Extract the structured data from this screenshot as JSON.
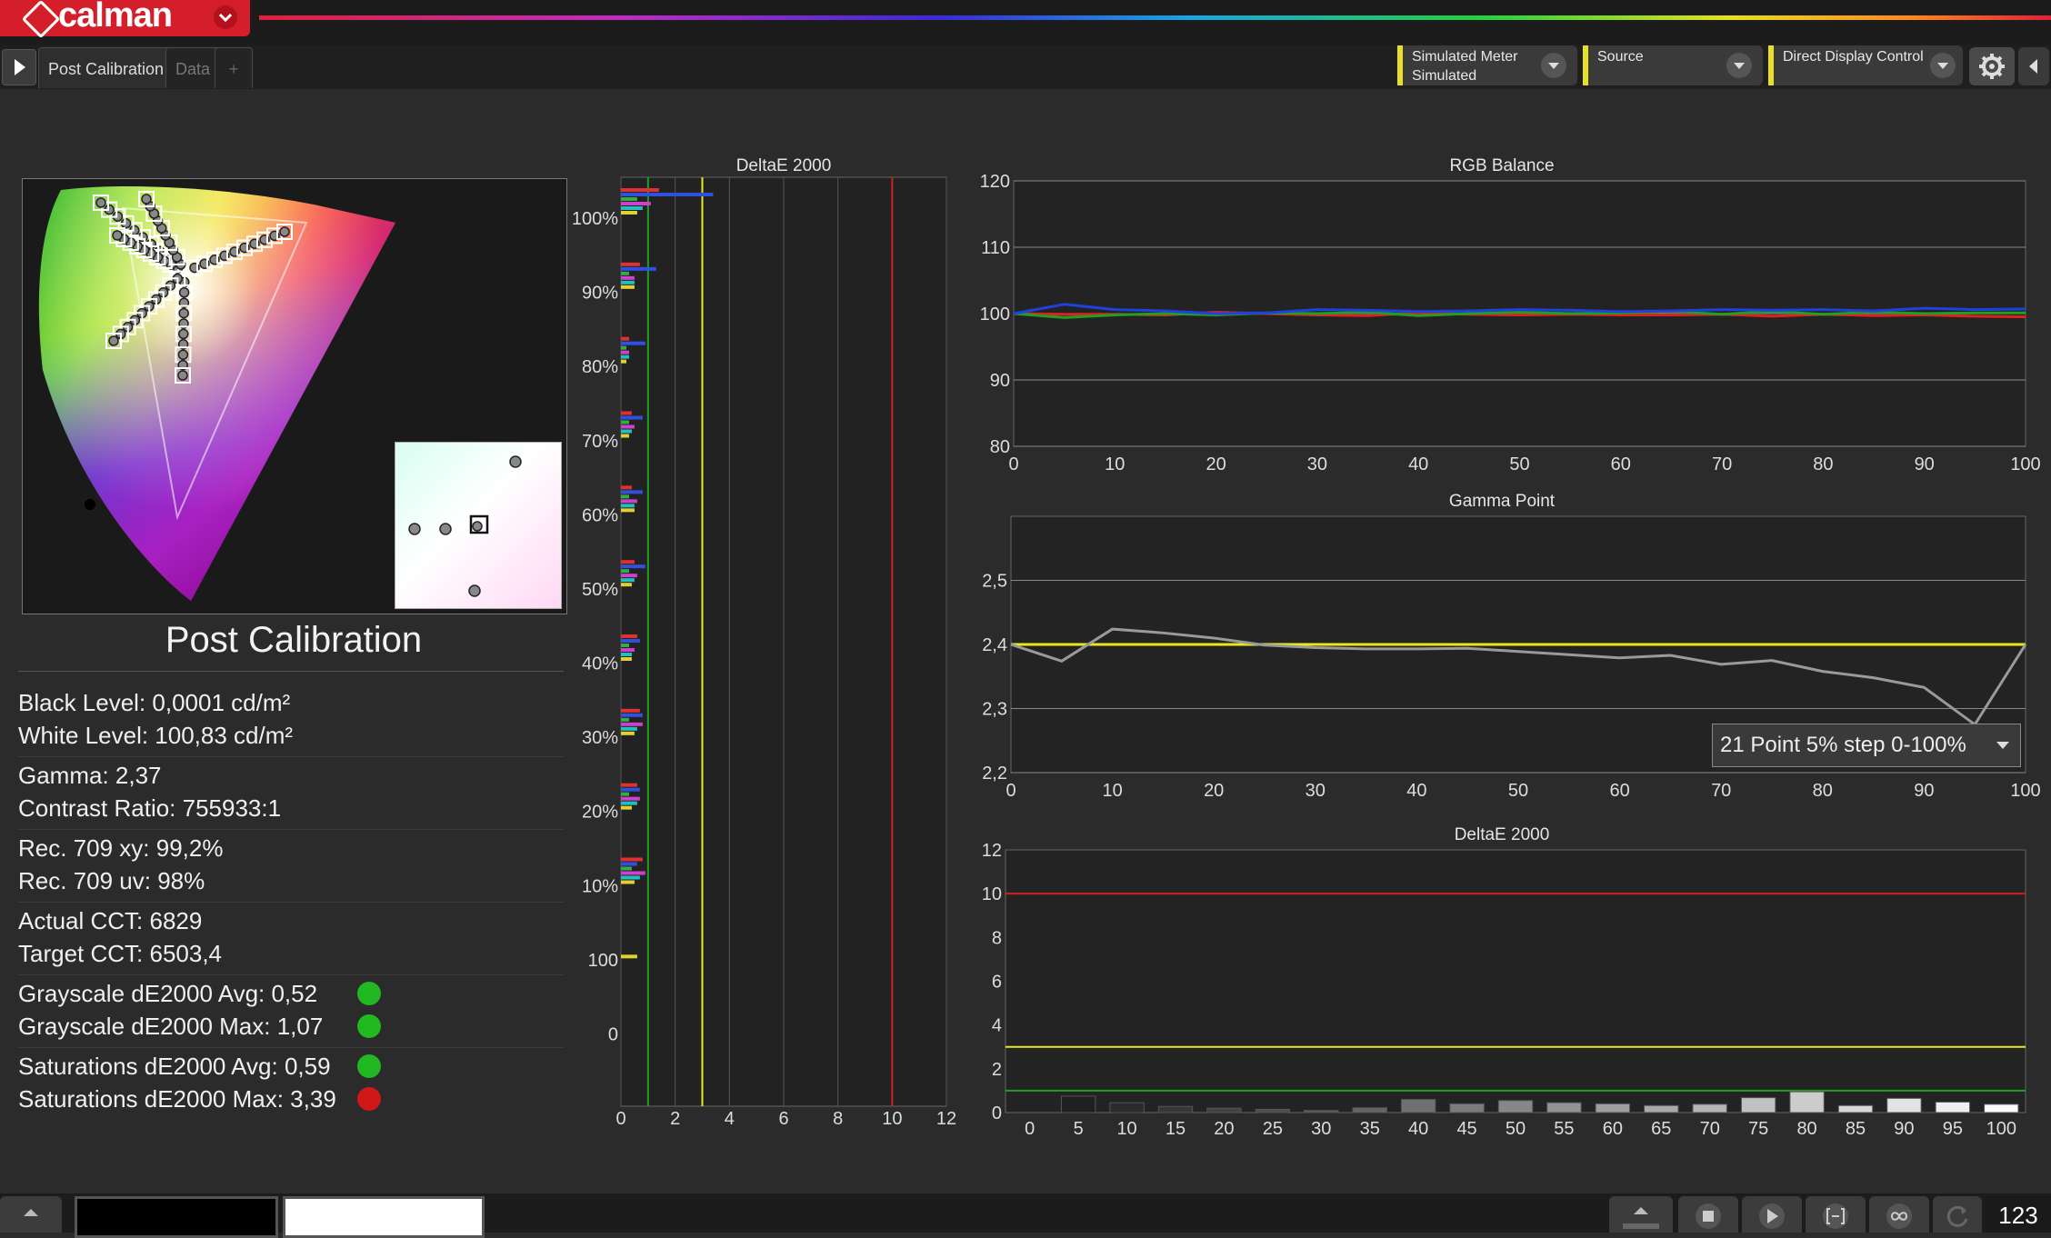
{
  "app": {
    "name": "calman"
  },
  "tabs": [
    {
      "label": "Post Calibration",
      "active": true
    },
    {
      "label": "Data",
      "active": false
    },
    {
      "label": "+",
      "active": false
    }
  ],
  "toolbar": {
    "meter": {
      "line1": "Simulated Meter",
      "line2": "Simulated"
    },
    "source": {
      "line1": "Source"
    },
    "display": {
      "line1": "Direct Display Control"
    },
    "settings_icon": "gear-icon",
    "accent_color": "#e8e028"
  },
  "panel": {
    "title": "Post Calibration",
    "stats": [
      {
        "label": "Black Level: 0,0001 cd/m²"
      },
      {
        "label": "White Level: 100,83 cd/m²"
      },
      {
        "label": "Gamma: 2,37"
      },
      {
        "label": "Contrast Ratio: 755933:1"
      },
      {
        "label": "Rec. 709 xy: 99,2%"
      },
      {
        "label": "Rec. 709 uv: 98%"
      },
      {
        "label": "Actual CCT: 6829"
      },
      {
        "label": "Target CCT: 6503,4"
      },
      {
        "label": "Grayscale dE2000 Avg: 0,52",
        "status": "green"
      },
      {
        "label": "Grayscale dE2000 Max: 1,07",
        "status": "green"
      },
      {
        "label": "Saturations dE2000 Avg: 0,59",
        "status": "green"
      },
      {
        "label": "Saturations dE2000 Max: 3,39",
        "status": "red"
      }
    ],
    "status_colors": {
      "green": "#22b822",
      "red": "#d01818"
    }
  },
  "charts": {
    "deltae_sat": {
      "title": "DeltaE 2000",
      "y_labels": [
        "100%",
        "90%",
        "80%",
        "70%",
        "60%",
        "50%",
        "40%",
        "30%",
        "20%",
        "10%",
        "100",
        "0"
      ],
      "x_ticks": [
        "0",
        "2",
        "4",
        "6",
        "8",
        "10",
        "12"
      ]
    },
    "rgb_balance": {
      "title": "RGB Balance",
      "y_ticks": [
        "120",
        "110",
        "100",
        "90",
        "80"
      ],
      "x_ticks": [
        "0",
        "10",
        "20",
        "30",
        "40",
        "50",
        "60",
        "70",
        "80",
        "90",
        "100"
      ]
    },
    "gamma_point": {
      "title": "Gamma Point",
      "y_ticks": [
        "2,5",
        "2,4",
        "2,3",
        "2,2"
      ],
      "x_ticks": [
        "0",
        "10",
        "20",
        "30",
        "40",
        "50",
        "60",
        "70",
        "80",
        "90",
        "100"
      ],
      "dropdown": "21 Point 5% step 0-100%"
    },
    "deltae_gray": {
      "title": "DeltaE 2000",
      "y_ticks": [
        "12",
        "10",
        "8",
        "6",
        "4",
        "2",
        "0"
      ],
      "x_ticks": [
        "0",
        "5",
        "10",
        "15",
        "20",
        "25",
        "30",
        "35",
        "40",
        "45",
        "50",
        "55",
        "60",
        "65",
        "70",
        "75",
        "80",
        "85",
        "90",
        "95",
        "100"
      ]
    }
  },
  "chart_data": [
    {
      "type": "bar",
      "title": "DeltaE 2000",
      "orientation": "horizontal",
      "categories": [
        "100%",
        "90%",
        "80%",
        "70%",
        "60%",
        "50%",
        "40%",
        "30%",
        "20%",
        "10%",
        "100",
        "0"
      ],
      "xlim": [
        0,
        12
      ],
      "thresholds": [
        1,
        3,
        10
      ],
      "series": [
        {
          "color": "#e03030",
          "values": [
            1.4,
            0.7,
            0.3,
            0.4,
            0.4,
            0.5,
            0.6,
            0.7,
            0.6,
            0.8,
            0,
            0
          ]
        },
        {
          "color": "#3050e0",
          "values": [
            3.4,
            1.3,
            0.9,
            0.8,
            0.8,
            0.9,
            0.7,
            0.8,
            0.7,
            0.6,
            0,
            0
          ]
        },
        {
          "color": "#30b040",
          "values": [
            0.6,
            0.3,
            0.2,
            0.3,
            0.3,
            0.3,
            0.3,
            0.3,
            0.3,
            0.4,
            0,
            0
          ]
        },
        {
          "color": "#d040d0",
          "values": [
            1.1,
            0.5,
            0.3,
            0.5,
            0.6,
            0.6,
            0.5,
            0.8,
            0.7,
            0.9,
            0,
            0
          ]
        },
        {
          "color": "#20c0c0",
          "values": [
            0.8,
            0.5,
            0.3,
            0.4,
            0.5,
            0.5,
            0.4,
            0.6,
            0.6,
            0.7,
            0,
            0
          ]
        },
        {
          "color": "#e0d030",
          "values": [
            0.6,
            0.5,
            0.2,
            0.3,
            0.5,
            0.4,
            0.4,
            0.5,
            0.4,
            0.5,
            0.6,
            0
          ]
        }
      ]
    },
    {
      "type": "line",
      "title": "RGB Balance",
      "x": [
        0,
        5,
        10,
        15,
        20,
        25,
        30,
        35,
        40,
        45,
        50,
        55,
        60,
        65,
        70,
        75,
        80,
        85,
        90,
        95,
        100
      ],
      "ylim": [
        80,
        120
      ],
      "series": [
        {
          "color": "#e02020",
          "values": [
            100,
            99.9,
            99.9,
            99.8,
            100.2,
            100.0,
            99.8,
            99.7,
            100.1,
            99.9,
            99.8,
            99.9,
            99.8,
            99.8,
            99.9,
            99.6,
            99.9,
            99.7,
            99.8,
            99.6,
            99.5
          ]
        },
        {
          "color": "#20a020",
          "values": [
            100,
            99.4,
            99.8,
            100.0,
            99.8,
            100.1,
            100.0,
            100.2,
            99.7,
            100.0,
            100.2,
            100.0,
            100.1,
            100.3,
            99.9,
            100.3,
            99.9,
            100.2,
            100.0,
            100.1,
            100.1
          ]
        },
        {
          "color": "#2040e0",
          "values": [
            100,
            101.4,
            100.6,
            100.4,
            100.0,
            100.1,
            100.6,
            100.5,
            100.3,
            100.4,
            100.6,
            100.5,
            100.3,
            100.4,
            100.6,
            100.5,
            100.6,
            100.4,
            100.8,
            100.6,
            100.7
          ]
        }
      ]
    },
    {
      "type": "line",
      "title": "Gamma Point",
      "x": [
        0,
        5,
        10,
        15,
        20,
        25,
        30,
        35,
        40,
        45,
        50,
        55,
        60,
        65,
        70,
        75,
        80,
        85,
        90,
        95,
        100
      ],
      "ylim": [
        2.2,
        2.6
      ],
      "series": [
        {
          "color": "#e8e820",
          "values": [
            2.4,
            2.4,
            2.4,
            2.4,
            2.4,
            2.4,
            2.4,
            2.4,
            2.4,
            2.4,
            2.4,
            2.4,
            2.4,
            2.4,
            2.4,
            2.4,
            2.4,
            2.4,
            2.4,
            2.4,
            2.4
          ]
        },
        {
          "color": "#9a9a9a",
          "values": [
            2.4,
            2.374,
            2.424,
            2.418,
            2.41,
            2.399,
            2.395,
            2.393,
            2.393,
            2.394,
            2.389,
            2.384,
            2.379,
            2.383,
            2.369,
            2.375,
            2.358,
            2.348,
            2.333,
            2.275,
            2.4
          ]
        }
      ]
    },
    {
      "type": "bar",
      "title": "DeltaE 2000",
      "categories": [
        "0",
        "5",
        "10",
        "15",
        "20",
        "25",
        "30",
        "35",
        "40",
        "45",
        "50",
        "55",
        "60",
        "65",
        "70",
        "75",
        "80",
        "85",
        "90",
        "95",
        "100"
      ],
      "values": [
        0,
        0.75,
        0.45,
        0.28,
        0.2,
        0.15,
        0.1,
        0.22,
        0.6,
        0.4,
        0.55,
        0.45,
        0.4,
        0.32,
        0.38,
        0.68,
        0.95,
        0.32,
        0.65,
        0.48,
        0.38
      ],
      "ylim": [
        0,
        12
      ],
      "thresholds": [
        1,
        3,
        10
      ]
    }
  ]
}
